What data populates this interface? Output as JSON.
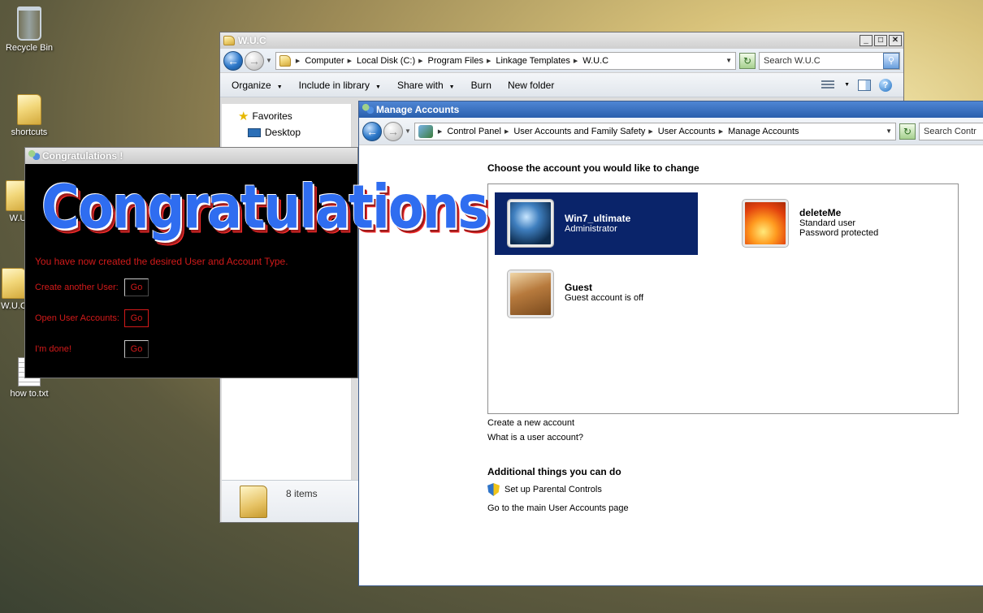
{
  "desktop": {
    "icons": [
      {
        "label": "Recycle Bin"
      },
      {
        "label": "shortcuts"
      },
      {
        "label": "W.U"
      },
      {
        "label": "W.U.C"
      },
      {
        "label": "how to.txt"
      }
    ]
  },
  "explorer": {
    "title": "W.U.C",
    "caption": {
      "minimize": "_",
      "maximize": "□",
      "close": "✕"
    },
    "breadcrumbs": [
      "Computer",
      "Local Disk (C:)",
      "Program Files",
      "Linkage Templates",
      "W.U.C"
    ],
    "search_placeholder": "Search W.U.C",
    "toolbar": {
      "organize": "Organize",
      "include_in_library": "Include in library",
      "share_with": "Share with",
      "burn": "Burn",
      "new_folder": "New folder"
    },
    "nav": {
      "favorites": "Favorites",
      "desktop": "Desktop"
    },
    "status": "8 items"
  },
  "manage": {
    "title": "Manage Accounts",
    "breadcrumbs": [
      "Control Panel",
      "User Accounts and Family Safety",
      "User Accounts",
      "Manage Accounts"
    ],
    "search_placeholder": "Search Contr",
    "heading": "Choose the account you would like to change",
    "accounts": [
      {
        "name": "Win7_ultimate",
        "lines": [
          "Administrator"
        ],
        "selected": true,
        "picture": "windows-logo-picture"
      },
      {
        "name": "deleteMe",
        "lines": [
          "Standard user",
          "Password protected"
        ],
        "selected": false,
        "picture": "orange-flower-picture"
      },
      {
        "name": "Guest",
        "lines": [
          "Guest account is off"
        ],
        "selected": false,
        "picture": "suitcase-picture"
      }
    ],
    "links": {
      "create": "Create a new account",
      "what_is": "What is a user account?"
    },
    "additional_heading": "Additional things you can do",
    "parental_controls": "Set up Parental Controls",
    "main_page": "Go to the main User Accounts page"
  },
  "congrats": {
    "title": "Congratulations !",
    "banner": "Congratulations",
    "message": "You have now created the desired User and Account Type.",
    "options": [
      {
        "label": "Create another User:",
        "button": "Go"
      },
      {
        "label": "Open User Accounts:",
        "button": "Go"
      },
      {
        "label": "I'm done!",
        "button": "Go"
      }
    ]
  },
  "colors": {
    "selected_account_bg": "#0a246a",
    "dialog_text": "#d21a1a",
    "banner_blue": "#2f6df0"
  }
}
